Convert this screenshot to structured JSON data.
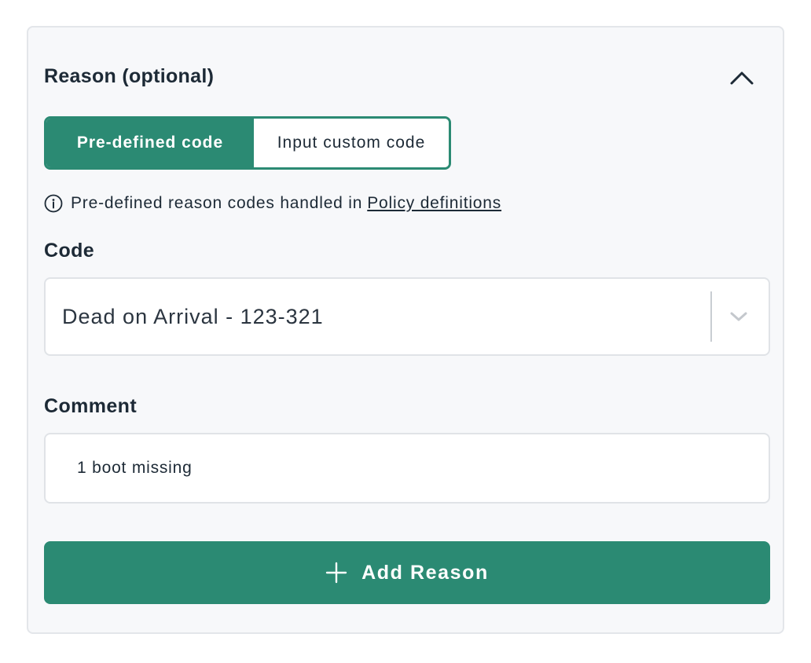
{
  "reason_section": {
    "title": "Reason (optional)",
    "collapse_icon": "chevron-up-icon"
  },
  "code_mode_toggle": {
    "options": [
      {
        "label": "Pre-defined code",
        "selected": true
      },
      {
        "label": "Input custom code",
        "selected": false
      }
    ]
  },
  "info_note": {
    "icon": "info-icon",
    "text": "Pre-defined reason codes handled in",
    "link_text": "Policy definitions"
  },
  "code_field": {
    "label": "Code",
    "selected_value": "Dead on Arrival - 123-321",
    "dropdown_icon": "chevron-down-icon"
  },
  "comment_field": {
    "label": "Comment",
    "value": "1 boot missing",
    "placeholder": ""
  },
  "add_button": {
    "icon": "plus-icon",
    "label": "Add Reason"
  },
  "colors": {
    "accent": "#2b8a73",
    "panel_background": "#f7f8fa",
    "text": "#1d2a36"
  }
}
